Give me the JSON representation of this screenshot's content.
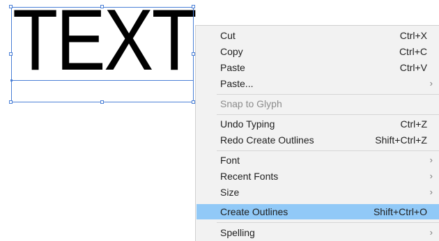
{
  "canvas": {
    "text_object": {
      "content": "TEXT"
    }
  },
  "context_menu": {
    "items": [
      {
        "label": "Cut",
        "shortcut": "Ctrl+X"
      },
      {
        "label": "Copy",
        "shortcut": "Ctrl+C"
      },
      {
        "label": "Paste",
        "shortcut": "Ctrl+V"
      },
      {
        "label": "Paste...",
        "submenu_icon": "chevron-right-icon"
      },
      {
        "label": "Snap to Glyph",
        "state": "disabled"
      },
      {
        "label": "Undo Typing",
        "shortcut": "Ctrl+Z"
      },
      {
        "label": "Redo Create Outlines",
        "shortcut": "Shift+Ctrl+Z"
      },
      {
        "label": "Font",
        "submenu_icon": "chevron-right-icon"
      },
      {
        "label": "Recent Fonts",
        "submenu_icon": "chevron-right-icon"
      },
      {
        "label": "Size",
        "submenu_icon": "chevron-right-icon"
      },
      {
        "label": "Create Outlines",
        "shortcut": "Shift+Ctrl+O",
        "state": "highlighted"
      },
      {
        "label": "Spelling",
        "submenu_icon": "chevron-right-icon"
      }
    ]
  },
  "colors": {
    "selection": "#4a7fd6",
    "menu_background": "#f2f2f2",
    "highlight": "#91c9f7",
    "disabled_text": "#8c8c8c"
  }
}
